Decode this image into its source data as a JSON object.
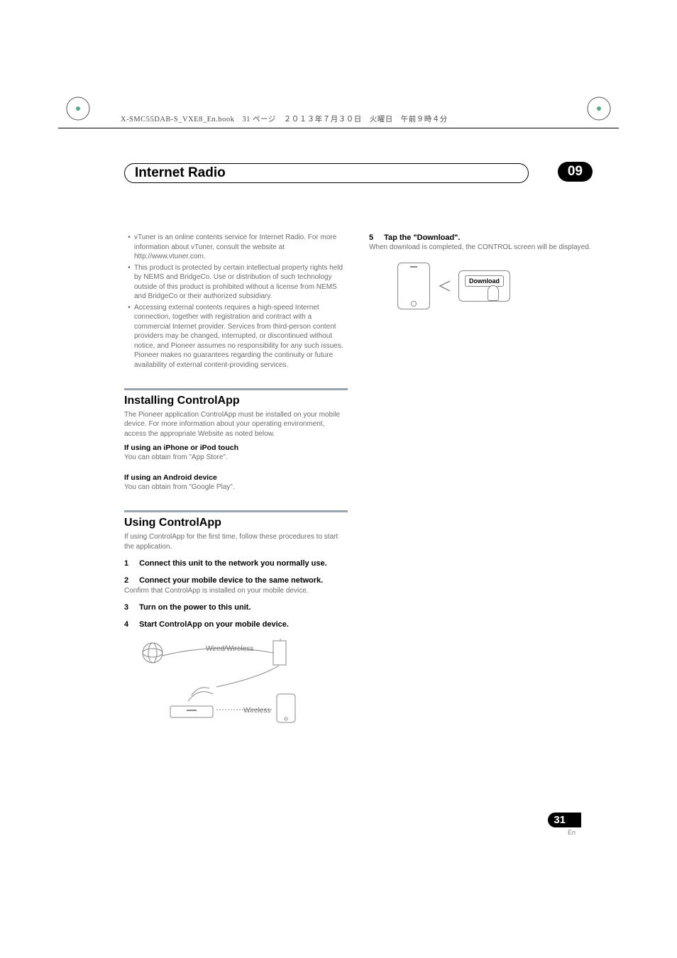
{
  "print_header": "X-SMC55DAB-S_VXE8_En.book　31 ページ　２０１３年７月３０日　火曜日　午前９時４分",
  "header": {
    "title": "Internet Radio",
    "chapter": "09"
  },
  "left_column": {
    "bullets": [
      "vTuner is an online contents service for Internet Radio. For more information about vTuner, consult the website at http://www.vtuner.com.",
      "This product is protected by certain intellectual property rights held by NEMS and BridgeCo. Use or distribution of such technology outside of this product is prohibited without a license from NEMS and BridgeCo or their authorized subsidiary.",
      "Accessing external contents requires a high-speed Internet connection, together with registration and contract with a commercial Internet provider. Services from third-person content providers may be changed, interrupted, or discontinued without notice, and Pioneer assumes no responsibility for any such issues. Pioneer makes no guarantees regarding the continuity or future availability of external content-providing services."
    ],
    "section1_heading": "Installing ControlApp",
    "section1_intro": "The Pioneer application ControlApp must be installed on your mobile device. For more information about your operating environment, access the appropriate Website as noted below.",
    "section1_sub1_title": "If using an iPhone or iPod touch",
    "section1_sub1_text": "You can obtain from \"App Store\".",
    "section1_sub2_title": "If using an Android device",
    "section1_sub2_text": "You can obtain from \"Google Play\".",
    "section2_heading": "Using ControlApp",
    "section2_intro": "If using ControlApp for the first time, follow these procedures to start the application.",
    "steps": [
      {
        "num": "1",
        "text": "Connect this unit to the network you normally use."
      },
      {
        "num": "2",
        "text": "Connect your mobile device to the same network."
      },
      {
        "num": "3",
        "text": "Turn on the power to this unit."
      },
      {
        "num": "4",
        "text": "Start ControlApp on your mobile device."
      }
    ],
    "step2_note": "Confirm that ControlApp is installed on your mobile device.",
    "illus_label1": "Wired/Wireless",
    "illus_label2": "Wireless"
  },
  "right_column": {
    "step5_num": "5",
    "step5_text": "Tap the \"Download\".",
    "step5_note": "When download is completed, the CONTROL screen will be displayed.",
    "download_btn": "Download"
  },
  "footer": {
    "page_num": "31",
    "lang": "En"
  }
}
